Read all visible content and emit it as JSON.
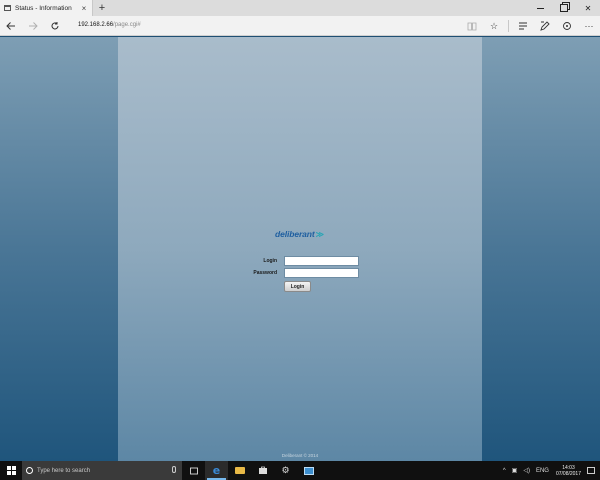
{
  "browser": {
    "tab_title": "Status - Information",
    "tab_close": "×",
    "new_tab": "+",
    "address_host": "192.168.2.66",
    "address_path": "/page.cgi#"
  },
  "login": {
    "logo_text": "deliberant",
    "logo_arrow": "≫",
    "login_label": "Login",
    "password_label": "Password",
    "login_value": "",
    "password_value": "",
    "button_label": "Login",
    "footer": "Deliberant © 2014"
  },
  "taskbar": {
    "search_placeholder": "Type here to search",
    "language": "ENG",
    "time": "14:03",
    "date": "07/08/2017"
  },
  "colors": {
    "accent": "#1f5fa0",
    "logo_arrow": "#2aa5b5",
    "taskbar": "#101010"
  }
}
